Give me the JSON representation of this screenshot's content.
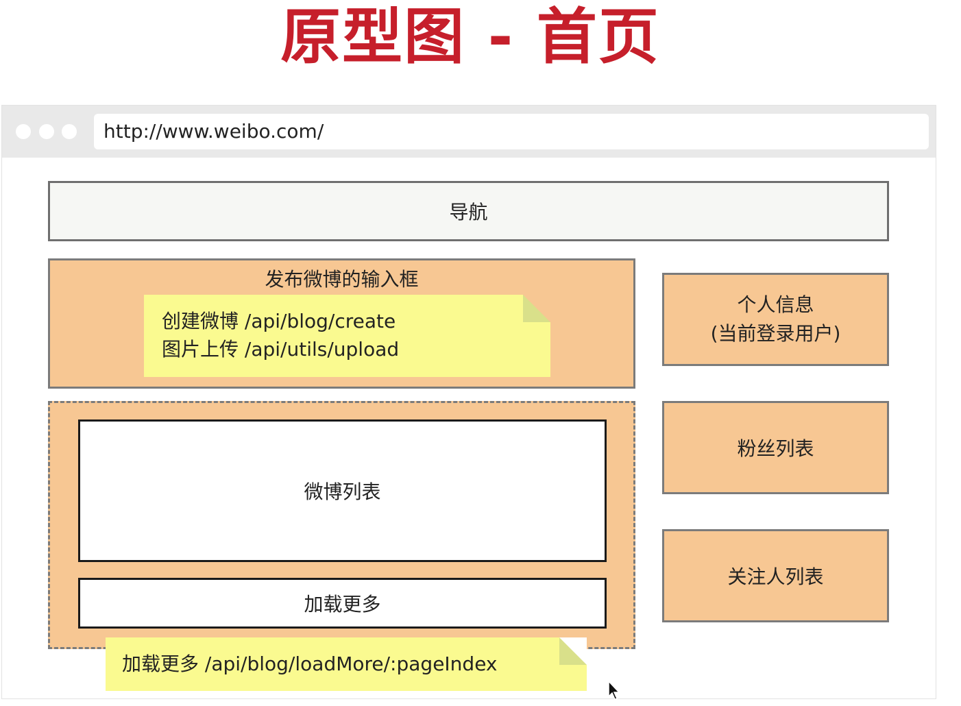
{
  "title": "原型图 - 首页",
  "browser": {
    "url": "http://www.weibo.com/"
  },
  "nav": {
    "label": "导航"
  },
  "compose": {
    "label": "发布微博的输入框",
    "note_line1": "创建微博 /api/blog/create",
    "note_line2": "图片上传 /api/utils/upload"
  },
  "feed": {
    "list_label": "微博列表",
    "load_more_label": "加载更多",
    "note": "加载更多 /api/blog/loadMore/:pageIndex"
  },
  "sidebar": {
    "profile_line1": "个人信息",
    "profile_line2": "(当前登录用户)",
    "fans_label": "粉丝列表",
    "following_label": "关注人列表"
  },
  "colors": {
    "title": "#c61f2b",
    "module_fill": "#f7c793",
    "nav_fill": "#f6f7f4",
    "note_fill": "#fafa90"
  },
  "icons": [
    "window-dot-icon",
    "mouse-cursor-icon",
    "note-fold-icon"
  ]
}
